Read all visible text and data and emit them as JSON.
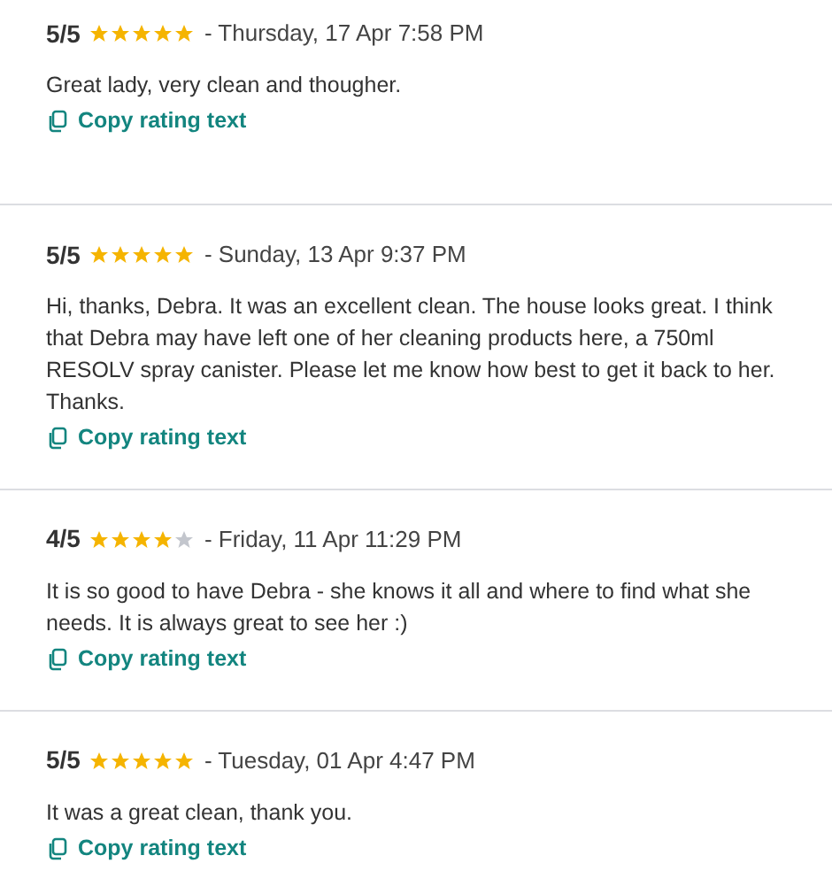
{
  "reviews": [
    {
      "score": "5/5",
      "stars": 5,
      "date": "- Thursday, 17 Apr 7:58 PM",
      "text": "Great lady, very clean and thougher.",
      "copy_link": "Copy rating text"
    },
    {
      "score": "5/5",
      "stars": 5,
      "date": "- Sunday, 13 Apr 9:37 PM",
      "text": "Hi, thanks, Debra. It was an excellent clean. The house looks great. I think that Debra may have left one of her cleaning products here, a 750ml RESOLV spray canister. Please let me know how best to get it back to her. Thanks.",
      "copy_link": "Copy rating text"
    },
    {
      "score": "4/5",
      "stars": 4,
      "date": "- Friday, 11 Apr 11:29 PM",
      "text": "It is so good to have Debra - she knows it all and where to find what she needs. It is always great to see her :)",
      "copy_link": "Copy rating text"
    },
    {
      "score": "5/5",
      "stars": 5,
      "date": "- Tuesday, 01 Apr 4:47 PM",
      "text": "It was a great clean, thank you.",
      "copy_link": "Copy rating text"
    }
  ]
}
